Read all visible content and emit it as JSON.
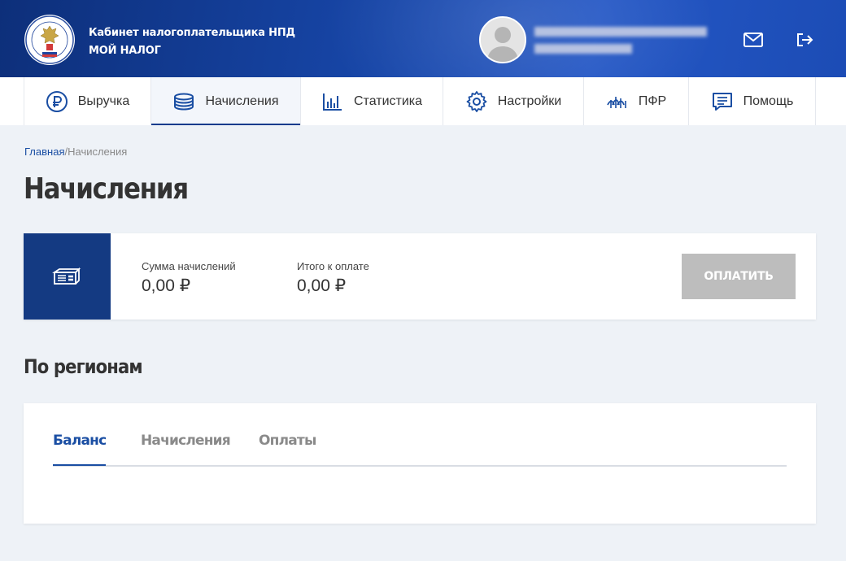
{
  "header": {
    "brand_line1": "Кабинет налогоплательщика НПД",
    "brand_line2": "МОЙ НАЛОГ",
    "emblem_icon": "fns-emblem-icon",
    "avatar_icon": "user-avatar-icon",
    "mail_icon": "mail-icon",
    "logout_icon": "logout-icon"
  },
  "nav": {
    "items": [
      {
        "label": "Выручка",
        "icon": "ruble-icon"
      },
      {
        "label": "Начисления",
        "icon": "coins-stack-icon",
        "active": true
      },
      {
        "label": "Статистика",
        "icon": "bar-chart-icon"
      },
      {
        "label": "Настройки",
        "icon": "gear-icon"
      },
      {
        "label": "ПФР",
        "icon": "pfr-logo-icon"
      },
      {
        "label": "Помощь",
        "icon": "help-chat-icon"
      }
    ]
  },
  "breadcrumb": {
    "home": "Главная",
    "separator": "/",
    "current": "Начисления"
  },
  "page_title": "Начисления",
  "summary": {
    "icon": "banknotes-icon",
    "accruals_label": "Сумма начислений",
    "accruals_value": "0,00 ₽",
    "total_label": "Итого к оплате",
    "total_value": "0,00 ₽",
    "pay_button": "ОПЛАТИТЬ"
  },
  "regions": {
    "title": "По регионам",
    "tabs": [
      {
        "label": "Баланс",
        "active": true
      },
      {
        "label": "Начисления"
      },
      {
        "label": "Оплаты"
      }
    ]
  },
  "colors": {
    "header_blue": "#1746a8",
    "accent_dark_blue": "#143a82",
    "link_blue": "#1a4ea3",
    "disabled_button": "#bdbdbd",
    "page_bg": "#eef2f7"
  }
}
